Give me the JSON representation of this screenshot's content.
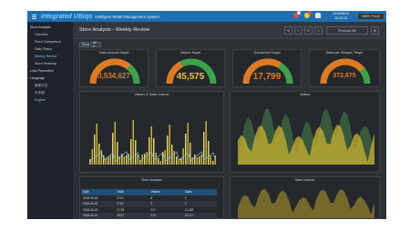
{
  "app": {
    "brand": "Integrated UBiqo",
    "subtitle": "Intelligent Retail Management System",
    "clock_date": "2018/08/19",
    "clock_time": "15:42:12",
    "top_button": "WMS: Pro41"
  },
  "icons": [
    "menu-icon",
    "shopping-bag-icon",
    "alert-icon",
    "user-icon"
  ],
  "colors": {
    "topbar": "#1e6fb0",
    "gauge_fill": "#e07a22",
    "gauge_track": "#3da34a",
    "accent": "#7fc3f2"
  },
  "sidebar": {
    "items": [
      {
        "label": "Store Analysis"
      },
      {
        "label": "Overview"
      },
      {
        "label": "Store Comparison"
      },
      {
        "label": "Daily Status"
      },
      {
        "label": "Weekly Review"
      },
      {
        "label": "Store Heatmap"
      },
      {
        "label": "Loss Prevention"
      },
      {
        "label": "Language"
      },
      {
        "label": "简体中文"
      },
      {
        "label": "日本語"
      },
      {
        "label": "English"
      }
    ]
  },
  "page": {
    "title": "Store Analysis - Weekly Review",
    "controls": [
      "⟲",
      "<",
      "↻",
      ">",
      "Previous 4W",
      "⚙"
    ],
    "filter_a": "Store",
    "filter_b": "All ▾"
  },
  "gauges": [
    {
      "title": "Sales Amount Target",
      "value": "3,534,627",
      "fraction": 0.72
    },
    {
      "title": "Visitors Target",
      "value": "45,575",
      "fraction": 0.35
    },
    {
      "title": "Transaction Target",
      "value": "17,799",
      "fraction": 0.68
    },
    {
      "title": "Sales per Shopper Target",
      "value": "372,675",
      "fraction": 0.78
    }
  ],
  "chart_visitors": {
    "title": "Visitors & Sales Volume",
    "legend": [
      "Sales",
      "Visitors"
    ]
  },
  "chart_status": {
    "title": "Visitors",
    "legend": [
      "This Week Visitors",
      "Last Week Visitors"
    ]
  },
  "table": {
    "title": "Store Analysis",
    "headers": [
      "Date",
      "Visits",
      "Visitors",
      "Sales"
    ],
    "rows": [
      [
        "2018-06-18",
        "2716",
        "8",
        "0"
      ],
      [
        "2018-06-19",
        "2716",
        "5",
        "0"
      ],
      [
        "2018-06-20",
        "2,135",
        "217",
        "11,028"
      ],
      [
        "2018-06-21",
        "40.57",
        "275",
        "22,117"
      ]
    ]
  },
  "chart_bottom": {
    "title": "Sales Volume"
  }
}
